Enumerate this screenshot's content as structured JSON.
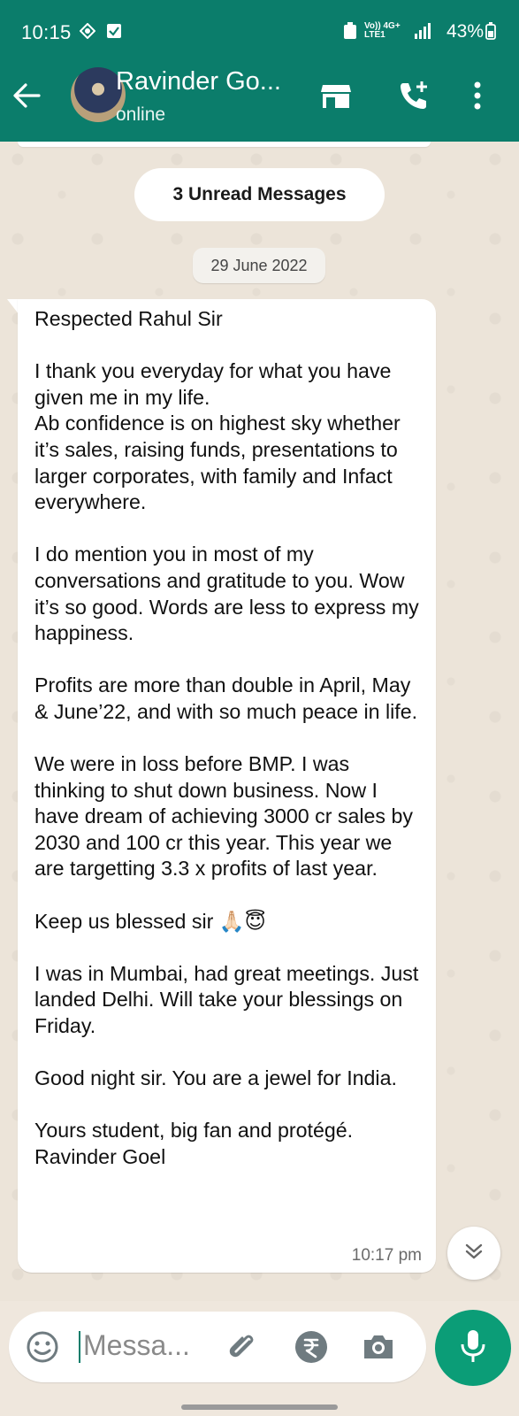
{
  "status_bar": {
    "time": "10:15",
    "network_top": "Vo)) 4G+",
    "network_bottom": "LTE1",
    "battery": "43%"
  },
  "header": {
    "contact_name": "Ravinder Go...",
    "contact_status": "online",
    "accent_color": "#0b7d6b"
  },
  "chat": {
    "unread_banner": "3 Unread Messages",
    "date_chip": "29 June 2022",
    "message": {
      "text": "Respected Rahul Sir\n\nI thank you everyday for what you have given me in my life.\nAb confidence is on highest sky whether it’s sales, raising funds, presentations to larger corporates, with family and Infact everywhere.\n\nI do mention you in most of my conversations and gratitude to you. Wow it’s so good. Words are less to express my happiness.\n\nProfits are more than double in April, May & June’22, and with so much peace in life.\n\nWe were in loss before BMP. I was thinking to shut down business. Now I have dream of achieving 3000 cr sales by 2030 and 100 cr this year. This year we are targetting 3.3 x profits of last year.\n\nKeep us blessed sir 🙏🏻😇\n\nI was in Mumbai, had great meetings. Just landed Delhi. Will take your blessings on Friday.\n\nGood night sir. You are a jewel for India.\n\nYours student, big fan and protégé.\nRavinder Goel",
      "time": "10:17 pm"
    }
  },
  "composer": {
    "placeholder": "Messa..."
  },
  "icons": [
    "back-arrow-icon",
    "shop-icon",
    "add-call-icon",
    "more-vert-icon",
    "emoji-icon",
    "attach-icon",
    "rupee-icon",
    "camera-icon",
    "mic-icon",
    "chevrons-down-icon"
  ]
}
